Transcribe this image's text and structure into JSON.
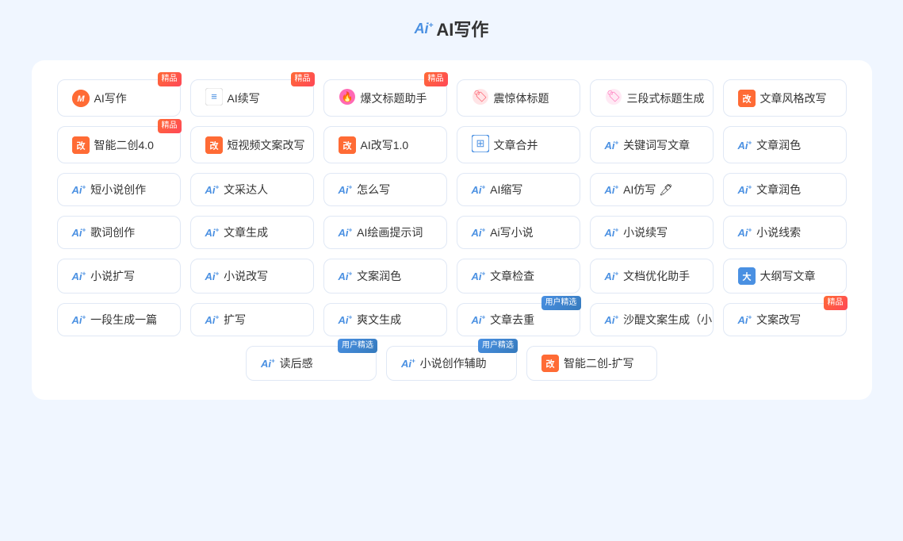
{
  "page": {
    "title": "AI写作",
    "title_prefix": "Ai"
  },
  "rows": [
    {
      "cards": [
        {
          "id": "ai-write",
          "icon_type": "circle-orange",
          "icon_text": "M",
          "label": "AI写作",
          "badge": "精品",
          "badge_type": "jingpin"
        },
        {
          "id": "ai-continue",
          "icon_type": "pen",
          "icon_text": "≡",
          "label": "AI续写",
          "badge": "精品",
          "badge_type": "jingpin"
        },
        {
          "id": "headline-helper",
          "icon_type": "flame-pink",
          "icon_text": "🔥",
          "label": "爆文标题助手",
          "badge": "精品",
          "badge_type": "jingpin"
        },
        {
          "id": "shocking-title",
          "icon_type": "flame-red",
          "icon_text": "🏷",
          "label": "震惊体标题",
          "badge": null
        },
        {
          "id": "three-para-title",
          "icon_type": "flame-pink2",
          "icon_text": "🏷",
          "label": "三段式标题生成",
          "badge": null
        },
        {
          "id": "article-style-rewrite",
          "icon_type": "square-orange",
          "icon_text": "改",
          "label": "文章风格改写",
          "badge": null
        }
      ]
    },
    {
      "cards": [
        {
          "id": "smart-recreate-4",
          "icon_type": "square-orange",
          "icon_text": "改",
          "label": "智能二创4.0",
          "badge": "精品",
          "badge_type": "jingpin"
        },
        {
          "id": "short-video-rewrite",
          "icon_type": "square-orange",
          "icon_text": "改",
          "label": "短视频文案改写",
          "badge": null
        },
        {
          "id": "ai-rewrite-1",
          "icon_type": "square-orange",
          "icon_text": "改",
          "label": "AI改写1.0",
          "badge": null
        },
        {
          "id": "article-merge",
          "icon_type": "merge-blue",
          "icon_text": "⊞",
          "label": "文章合并",
          "badge": null
        },
        {
          "id": "keyword-write",
          "icon_type": "ai-blue",
          "icon_text": "Ai+",
          "label": "关键词写文章",
          "badge": null
        },
        {
          "id": "article-polish1",
          "icon_type": "ai-blue",
          "icon_text": "Ai+",
          "label": "文章润色",
          "badge": null
        }
      ]
    },
    {
      "cards": [
        {
          "id": "short-novel-create",
          "icon_type": "ai-blue",
          "icon_text": "Ai+",
          "label": "短小说创作",
          "badge": null
        },
        {
          "id": "writing-talent",
          "icon_type": "ai-blue",
          "icon_text": "Ai+",
          "label": "文采达人",
          "badge": null
        },
        {
          "id": "how-to-write",
          "icon_type": "ai-blue",
          "icon_text": "Ai+",
          "label": "怎么写",
          "badge": null
        },
        {
          "id": "ai-shorten",
          "icon_type": "ai-blue",
          "icon_text": "Ai+",
          "label": "AI缩写",
          "badge": null
        },
        {
          "id": "ai-imitate",
          "icon_type": "ai-blue",
          "icon_text": "Ai+",
          "label": "AI仿写 🖊",
          "badge": null
        },
        {
          "id": "article-polish2",
          "icon_type": "ai-blue",
          "icon_text": "Ai+",
          "label": "文章润色",
          "badge": null
        }
      ]
    },
    {
      "cards": [
        {
          "id": "lyric-create",
          "icon_type": "ai-blue",
          "icon_text": "Ai+",
          "label": "歌词创作",
          "badge": null
        },
        {
          "id": "article-generate",
          "icon_type": "ai-blue",
          "icon_text": "Ai+",
          "label": "文章生成",
          "badge": null
        },
        {
          "id": "ai-paint-prompt",
          "icon_type": "ai-blue",
          "icon_text": "Ai+",
          "label": "AI绘画提示词",
          "badge": null
        },
        {
          "id": "ai-write-novel",
          "icon_type": "ai-blue",
          "icon_text": "Ai+",
          "label": "Ai写小说",
          "badge": null
        },
        {
          "id": "novel-continue",
          "icon_type": "ai-blue",
          "icon_text": "Ai+",
          "label": "小说续写",
          "badge": null
        },
        {
          "id": "novel-outline",
          "icon_type": "ai-blue",
          "icon_text": "Ai+",
          "label": "小说线索",
          "badge": null
        }
      ]
    },
    {
      "cards": [
        {
          "id": "novel-expand",
          "icon_type": "ai-blue",
          "icon_text": "Ai+",
          "label": "小说扩写",
          "badge": null
        },
        {
          "id": "novel-rewrite",
          "icon_type": "ai-blue",
          "icon_text": "Ai+",
          "label": "小说改写",
          "badge": null
        },
        {
          "id": "copy-polish",
          "icon_type": "ai-blue",
          "icon_text": "Ai+",
          "label": "文案润色",
          "badge": null
        },
        {
          "id": "article-check",
          "icon_type": "ai-blue",
          "icon_text": "Ai+",
          "label": "文章检查",
          "badge": null
        },
        {
          "id": "doc-optimize",
          "icon_type": "ai-blue",
          "icon_text": "Ai+",
          "label": "文档优化助手",
          "badge": null
        },
        {
          "id": "outline-write",
          "icon_type": "square-blue",
          "icon_text": "大",
          "label": "大纲写文章",
          "badge": null
        }
      ]
    },
    {
      "cards": [
        {
          "id": "one-para-generate",
          "icon_type": "ai-blue",
          "icon_text": "Ai+",
          "label": "一段生成一篇",
          "badge": null
        },
        {
          "id": "expand-write",
          "icon_type": "ai-blue",
          "icon_text": "Ai+",
          "label": "扩写",
          "badge": null
        },
        {
          "id": "cool-generate",
          "icon_type": "ai-blue",
          "icon_text": "Ai+",
          "label": "爽文生成",
          "badge": null
        },
        {
          "id": "article-dedup",
          "icon_type": "ai-blue",
          "icon_text": "Ai+",
          "label": "文章去重",
          "badge": "用户精选",
          "badge_type": "user"
        },
        {
          "id": "shahe-copy",
          "icon_type": "ai-blue",
          "icon_text": "Ai+",
          "label": "沙醍文案生成（小",
          "badge": null
        },
        {
          "id": "copy-rewrite",
          "icon_type": "ai-blue",
          "icon_text": "Ai+",
          "label": "文案改写",
          "badge": "精品",
          "badge_type": "jingpin"
        }
      ]
    },
    {
      "center": true,
      "cards": [
        {
          "id": "reading-notes",
          "icon_type": "ai-blue",
          "icon_text": "Ai+",
          "label": "读后感",
          "badge": "用户精选",
          "badge_type": "user"
        },
        {
          "id": "novel-create-assist",
          "icon_type": "ai-blue",
          "icon_text": "Ai+",
          "label": "小说创作辅助",
          "badge": "用户精选",
          "badge_type": "user"
        },
        {
          "id": "smart-recreate-expand",
          "icon_type": "square-orange",
          "icon_text": "改",
          "label": "智能二创-扩写",
          "badge": null
        }
      ]
    }
  ]
}
